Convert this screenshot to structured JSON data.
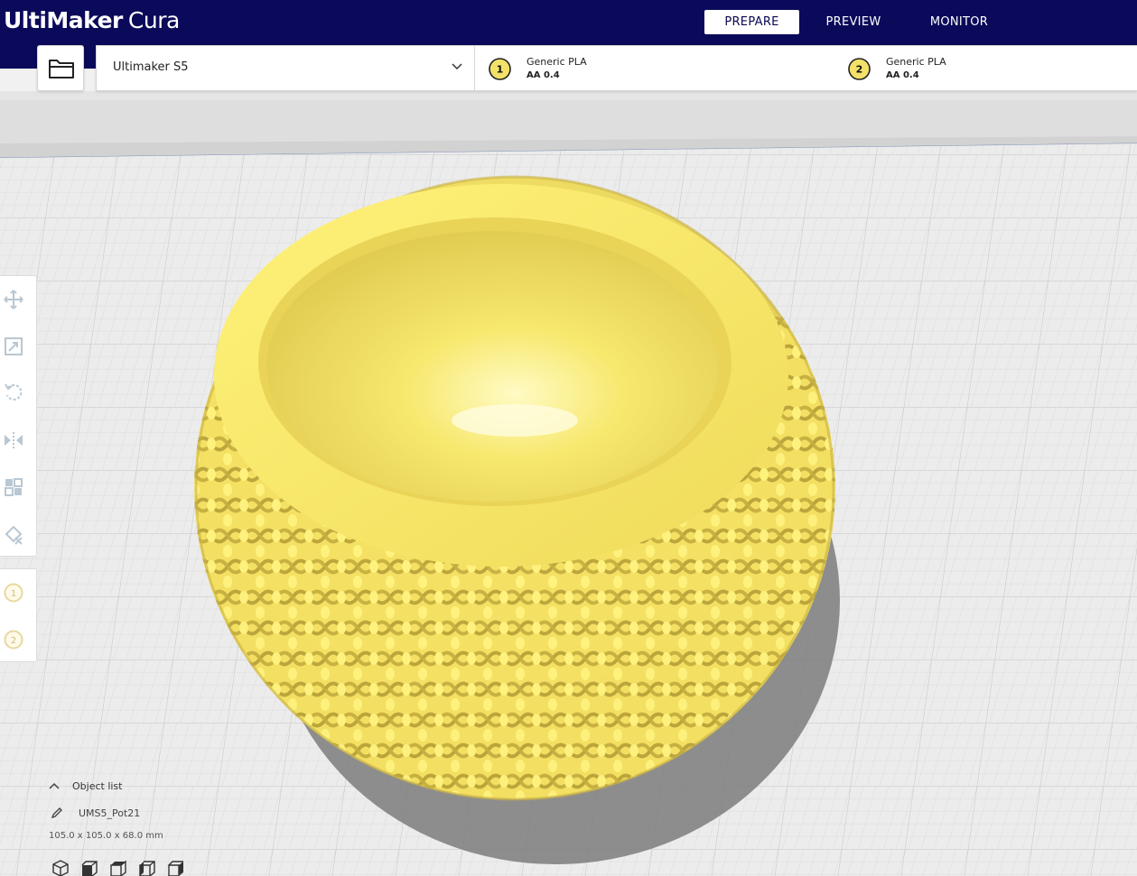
{
  "brand": {
    "bold": "UltiMaker",
    "light": "Cura"
  },
  "stages": [
    {
      "label": "PREPARE",
      "active": true
    },
    {
      "label": "PREVIEW",
      "active": false
    },
    {
      "label": "MONITOR",
      "active": false
    }
  ],
  "open_file": {
    "icon": "folder-icon"
  },
  "printer": {
    "name": "Ultimaker S5",
    "icon": "chevron-down-icon"
  },
  "extruders": [
    {
      "number": "1",
      "material": "Generic PLA",
      "nozzle": "AA 0.4"
    },
    {
      "number": "2",
      "material": "Generic PLA",
      "nozzle": "AA 0.4"
    }
  ],
  "tools": [
    {
      "icon": "move-icon"
    },
    {
      "icon": "scale-icon"
    },
    {
      "icon": "rotate-icon"
    },
    {
      "icon": "mirror-icon"
    },
    {
      "icon": "per-model-settings-icon"
    },
    {
      "icon": "support-blocker-icon"
    }
  ],
  "extruder_tools": [
    {
      "label": "1"
    },
    {
      "label": "2"
    }
  ],
  "object_list": {
    "title": "Object list",
    "object_name": "UMS5_Pot21",
    "dimensions": "105.0 x 105.0 x 68.0 mm",
    "view_buttons": [
      {
        "icon": "view-3d-icon"
      },
      {
        "icon": "view-front-icon"
      },
      {
        "icon": "view-top-icon"
      },
      {
        "icon": "view-left-icon"
      },
      {
        "icon": "view-right-icon"
      }
    ]
  },
  "colors": {
    "header": "#0b0a5a",
    "model": "#f6e56a",
    "model_shadow": "#d9c24a",
    "grid_bg": "#ececec"
  }
}
